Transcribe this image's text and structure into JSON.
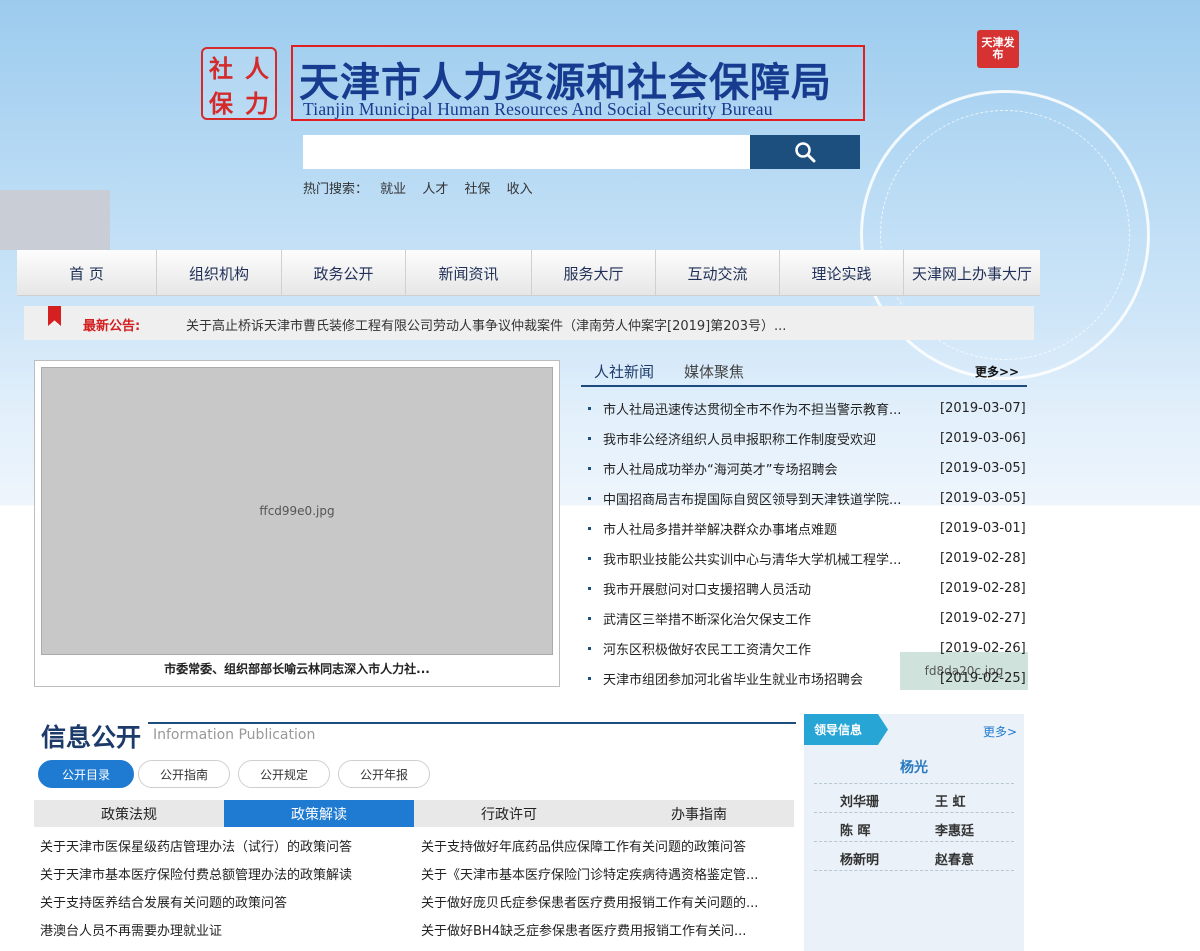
{
  "header": {
    "logo_chars": [
      "社",
      "人",
      "保",
      "力"
    ],
    "title_cn": "天津市人力资源和社会保障局",
    "title_en": "Tianjin Municipal Human Resources And Social Security Bureau",
    "seal_text": "天津发布",
    "search_placeholder": "",
    "hot_label": "热门搜索：",
    "hot_keywords": [
      "就业",
      "人才",
      "社保",
      "收入"
    ]
  },
  "nav": [
    "首 页",
    "组织机构",
    "政务公开",
    "新闻资讯",
    "服务大厅",
    "互动交流",
    "理论实践",
    "天津网上办事大厅"
  ],
  "notice": {
    "label": "最新公告:",
    "text": "关于高止桥诉天津市曹氏装修工程有限公司劳动人事争议仲裁案件（津南劳人仲案字[2019]第203号）..."
  },
  "photo": {
    "caption": "市委常委、组织部部长喻云林同志深入市人力社..."
  },
  "news": {
    "tabs": [
      "人社新闻",
      "媒体聚焦"
    ],
    "more": "更多>>",
    "items": [
      {
        "title": "市人社局迅速传达贯彻全市不作为不担当警示教育...",
        "date": "[2019-03-07]"
      },
      {
        "title": "我市非公经济组织人员申报职称工作制度受欢迎",
        "date": "[2019-03-06]"
      },
      {
        "title": "市人社局成功举办“海河英才”专场招聘会",
        "date": "[2019-03-05]"
      },
      {
        "title": "中国招商局吉布提国际自贸区领导到天津铁道学院...",
        "date": "[2019-03-05]"
      },
      {
        "title": "市人社局多措并举解决群众办事堵点难题",
        "date": "[2019-03-01]"
      },
      {
        "title": "我市职业技能公共实训中心与清华大学机械工程学...",
        "date": "[2019-02-28]"
      },
      {
        "title": "我市开展慰问对口支援招聘人员活动",
        "date": "[2019-02-28]"
      },
      {
        "title": "武清区三举措不断深化治欠保支工作",
        "date": "[2019-02-27]"
      },
      {
        "title": "河东区积极做好农民工工资清欠工作",
        "date": "[2019-02-26]"
      },
      {
        "title": "天津市组团参加河北省毕业生就业市场招聘会",
        "date": "[2019-02-25]"
      }
    ]
  },
  "info": {
    "title": "信息公开",
    "subtitle": "Information Publication",
    "pills": [
      "公开目录",
      "公开指南",
      "公开规定",
      "公开年报"
    ],
    "subtabs": [
      "政策法规",
      "政策解读",
      "行政许可",
      "办事指南"
    ],
    "docs_left": [
      "关于天津市医保星级药店管理办法（试行）的政策问答",
      "关于天津市基本医疗保险付费总额管理办法的政策解读",
      "关于支持医养结合发展有关问题的政策问答",
      "港澳台人员不再需要办理就业证"
    ],
    "docs_right": [
      "关于支持做好年底药品供应保障工作有关问题的政策问答",
      "关于《天津市基本医疗保险门诊特定疾病待遇资格鉴定管...",
      "关于做好庞贝氏症参保患者医疗费用报销工作有关问题的...",
      "关于做好BH4缺乏症参保患者医疗费用报销工作有关问..."
    ]
  },
  "leaders": {
    "heading": "领导信息",
    "more": "更多>",
    "main": "杨光",
    "rows": [
      [
        "刘华珊",
        "王 虹"
      ],
      [
        "陈 晖",
        "李惠廷"
      ],
      [
        "杨新明",
        "赵春意"
      ]
    ]
  },
  "colors": {
    "brand_blue": "#1d4f7e",
    "accent_blue": "#1f7bd1",
    "alert_red": "#d42020",
    "leader_cyan": "#27a6d6"
  }
}
